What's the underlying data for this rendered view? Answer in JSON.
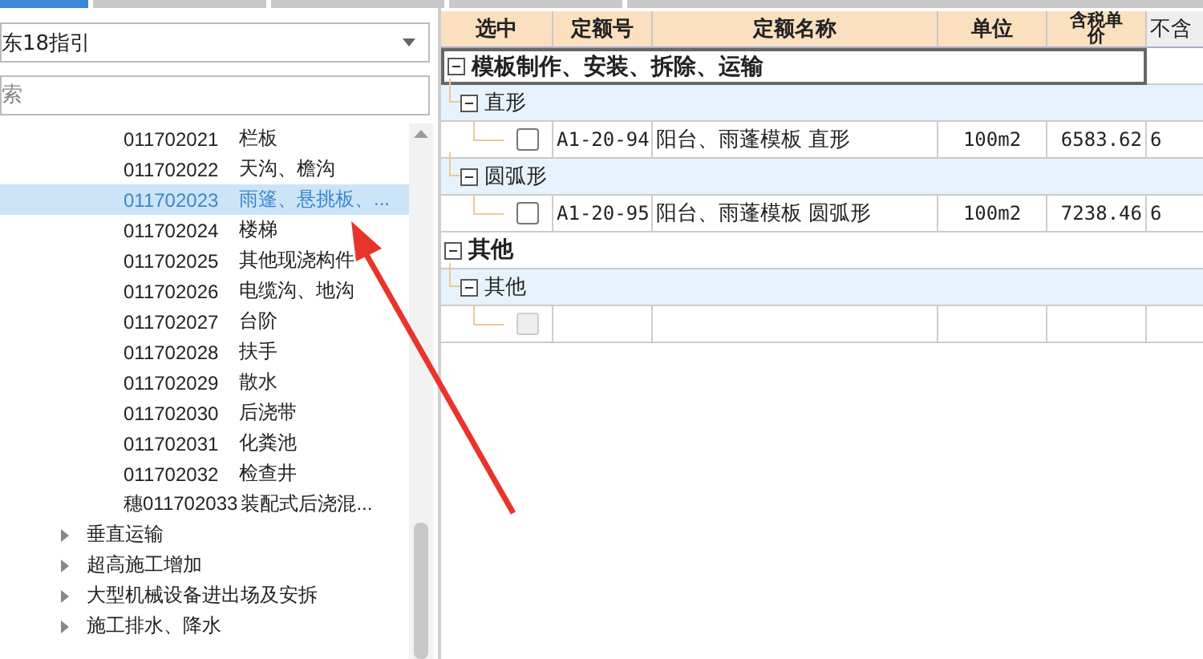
{
  "top_tabs": [
    {
      "selected": true
    },
    {
      "selected": false
    },
    {
      "selected": false
    },
    {
      "selected": false
    },
    {
      "selected": false
    }
  ],
  "library_select": {
    "value": "东18指引"
  },
  "search": {
    "placeholder": "索"
  },
  "tree": [
    {
      "kind": "leaf",
      "code": "011702021",
      "name": "栏板",
      "selected": false
    },
    {
      "kind": "leaf",
      "code": "011702022",
      "name": "天沟、檐沟",
      "selected": false
    },
    {
      "kind": "leaf",
      "code": "011702023",
      "name": "雨篷、悬挑板、...",
      "selected": true
    },
    {
      "kind": "leaf",
      "code": "011702024",
      "name": "楼梯",
      "selected": false
    },
    {
      "kind": "leaf",
      "code": "011702025",
      "name": "其他现浇构件",
      "selected": false
    },
    {
      "kind": "leaf",
      "code": "011702026",
      "name": "电缆沟、地沟",
      "selected": false
    },
    {
      "kind": "leaf",
      "code": "011702027",
      "name": "台阶",
      "selected": false
    },
    {
      "kind": "leaf",
      "code": "011702028",
      "name": "扶手",
      "selected": false
    },
    {
      "kind": "leaf",
      "code": "011702029",
      "name": "散水",
      "selected": false
    },
    {
      "kind": "leaf",
      "code": "011702030",
      "name": "后浇带",
      "selected": false
    },
    {
      "kind": "leaf",
      "code": "011702031",
      "name": "化粪池",
      "selected": false
    },
    {
      "kind": "leaf",
      "code": "011702032",
      "name": "检查井",
      "selected": false
    },
    {
      "kind": "leaf",
      "code": "穗011702033",
      "name": "装配式后浇混...",
      "selected": false
    },
    {
      "kind": "node",
      "name": "垂直运输",
      "expanded": false,
      "selected": false
    },
    {
      "kind": "node",
      "name": "超高施工增加",
      "expanded": false,
      "selected": false
    },
    {
      "kind": "node",
      "name": "大型机械设备进出场及安拆",
      "expanded": false,
      "selected": false
    },
    {
      "kind": "node",
      "name": "施工排水、降水",
      "expanded": false,
      "selected": false
    }
  ],
  "table": {
    "columns": [
      "选中",
      "定额号",
      "定额名称",
      "单位",
      "含税单价",
      "不含"
    ],
    "groups": [
      {
        "name": "模板制作、安装、拆除、运输",
        "expanded": true,
        "focused": true,
        "children": [
          {
            "name": "直形",
            "expanded": true,
            "rows": [
              {
                "checked": false,
                "disabled": false,
                "code": "A1-20-94",
                "name": "阳台、雨蓬模板 直形",
                "unit": "100m2",
                "price": "6583.62",
                "column_6": "6"
              }
            ]
          },
          {
            "name": "圆弧形",
            "expanded": true,
            "rows": [
              {
                "checked": false,
                "disabled": false,
                "code": "A1-20-95",
                "name": "阳台、雨蓬模板 圆弧形",
                "unit": "100m2",
                "price": "7238.46",
                "column_6": "6"
              }
            ]
          }
        ]
      },
      {
        "name": "其他",
        "expanded": true,
        "focused": false,
        "children": [
          {
            "name": "其他",
            "expanded": true,
            "rows": [
              {
                "checked": false,
                "disabled": true
              }
            ]
          }
        ]
      }
    ]
  }
}
